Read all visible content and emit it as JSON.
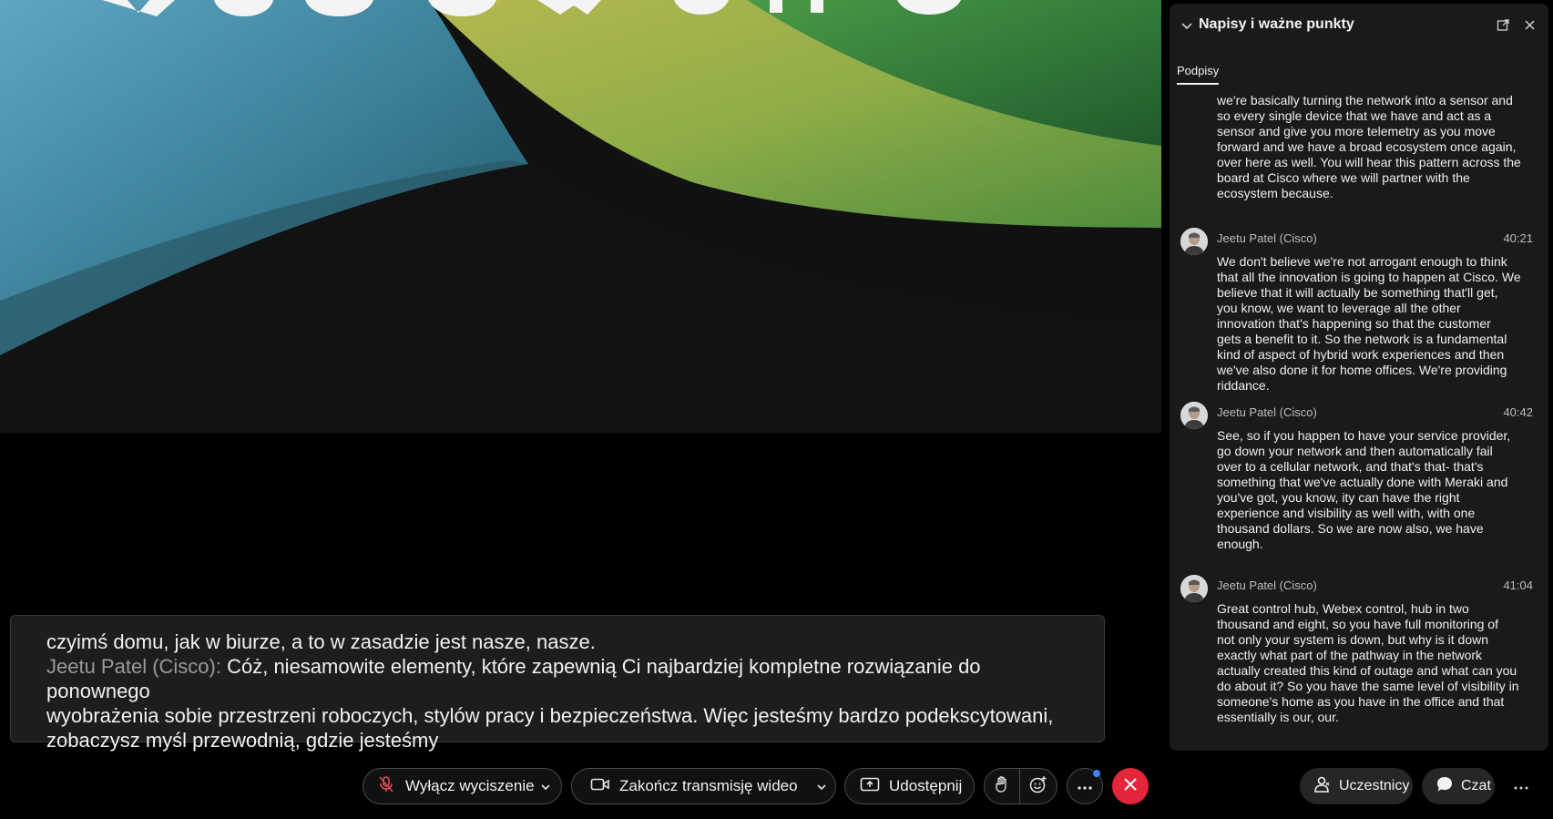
{
  "captions_panel": {
    "title": "Napisy i ważne punkty",
    "tabs": [
      {
        "label": "Podpisy",
        "active": true
      }
    ],
    "lead_text": "we're basically turning the network into a sensor and\nso every single device that we have and act as a\nsensor and give you more telemetry as you move\nforward and we have a broad ecosystem once again,\nover here as well. You will hear this pattern across the\nboard at Cisco where we will partner with the\necosystem because.",
    "entries": [
      {
        "speaker": "Jeetu Patel (Cisco)",
        "time": "40:21",
        "text": "We don't believe we're not arrogant enough to think\nthat all the innovation is going to happen at Cisco. We\nbelieve that it will actually be something that'll get,\nyou know, we want to leverage all the other\ninnovation that's happening so that the customer\ngets a benefit to it. So the network is a fundamental\nkind of aspect of hybrid work experiences and then\nwe've also done it for home offices. We're providing\nriddance."
      },
      {
        "speaker": "Jeetu Patel (Cisco)",
        "time": "40:42",
        "text": "See, so if you happen to have your service provider,\ngo down your network and then automatically fail\nover to a cellular network, and that's that- that's\nsomething that we've actually done with Meraki and\nyou've got, you know, ity can have the right\nexperience and visibility as well with, with one\nthousand dollars. So we are now also, we have\nenough."
      },
      {
        "speaker": "Jeetu Patel (Cisco)",
        "time": "41:04",
        "text": "Great control hub, Webex control, hub in two\nthousand and eight, so you have full monitoring of\nnot only your system is down, but why is it down\nexactly what part of the pathway in the network\nactually created this kind of outage and what can you\ndo about it? So you have the same level of visibility in\nsomeone's home as you have in the office and that\nessentially is our, our."
      }
    ]
  },
  "live_caption": {
    "line1": "czyimś domu, jak w biurze, a to w zasadzie jest nasze, nasze.",
    "speaker": "Jeetu Patel (Cisco):",
    "text_first": "Cóż, niesamowite elementy, które zapewnią Ci najbardziej kompletne rozwiązanie do ponownego",
    "line3": "wyobrażenia sobie przestrzeni roboczych, stylów pracy i bezpieczeństwa. Więc jesteśmy bardzo podekscytowani,",
    "line4": "zobaczysz myśl przewodnią, gdzie jesteśmy"
  },
  "controls": {
    "mute_label": "Wyłącz wyciszenie",
    "video_label": "Zakończ transmisję wideo",
    "share_label": "Udostępnij",
    "participants_label": "Uczestnicy",
    "chat_label": "Czat",
    "icons": [
      "mic-muted-icon",
      "chevron-down-icon",
      "camera-icon",
      "share-screen-icon",
      "raise-hand-icon",
      "reactions-icon",
      "more-icon",
      "leave-call-icon",
      "participants-icon",
      "chat-icon"
    ],
    "leave_color": "#e3263a",
    "badge_color": "#3b82f6"
  }
}
